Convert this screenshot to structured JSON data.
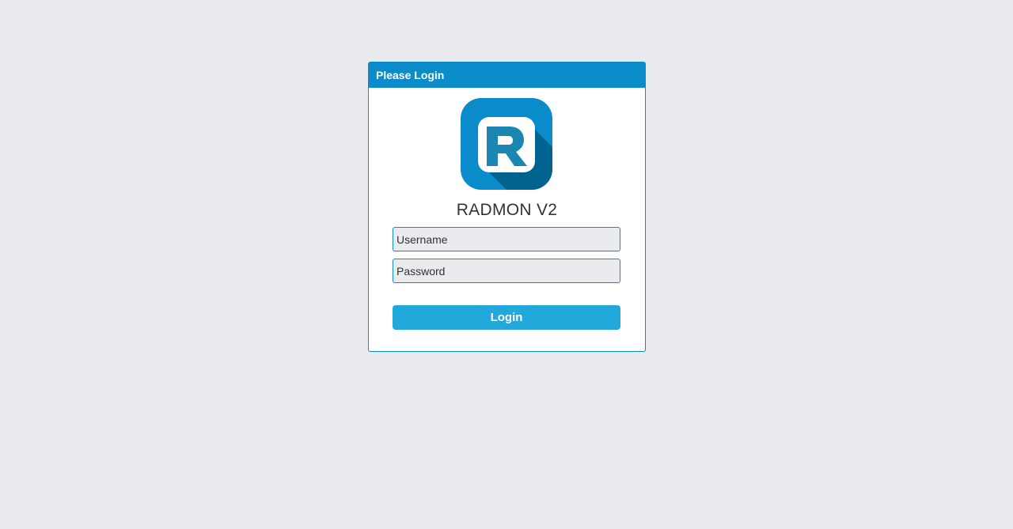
{
  "panel": {
    "header_title": "Please Login",
    "app_title": "RADMON V2",
    "logo_icon": "radmon-r-logo-icon"
  },
  "form": {
    "username_placeholder": "Username",
    "password_placeholder": "Password",
    "login_label": "Login"
  },
  "colors": {
    "background": "#e9ebee",
    "accent": "#0a8ccb",
    "button": "#22a8da",
    "logo_shadow": "#00628f"
  }
}
